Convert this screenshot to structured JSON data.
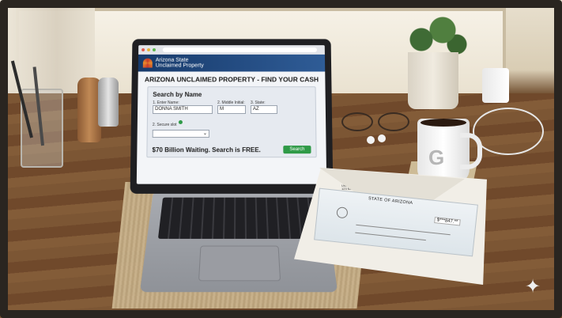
{
  "browser": {
    "controls": [
      "close",
      "minimize",
      "maximize"
    ]
  },
  "site": {
    "org_line1": "Arizona State",
    "org_line2": "Unclaimed Property",
    "page_title": "ARIZONA UNCLAIMED PROPERTY - FIND YOUR CASH",
    "search": {
      "heading": "Search by Name",
      "name_label": "1. Enter Name:",
      "name_value": "DONNA SMITH",
      "middle_label": "2. Middle Initial:",
      "middle_value": "M",
      "state_label": "3. State:",
      "state_value": "AZ",
      "secure_label": "2. Secure slot",
      "secure_value": "",
      "button_label": "Search"
    },
    "tagline": "$70 Billion Waiting. Search is FREE."
  },
  "envelope": {
    "return_address": [
      "STATE OF ARIZONA",
      "Unclaimed Property",
      "123 Main St",
      "Phoenix, AZ 85001"
    ]
  },
  "check": {
    "title": "STATE OF ARIZONA",
    "amount": "$***847.**"
  },
  "mug": {
    "logo": "G"
  },
  "colors": {
    "header_blue": "#173a6b",
    "button_green": "#2f9a47",
    "desk_wood": "#7c5634"
  },
  "icons": [
    "secure-check-icon",
    "dropdown-chevron-icon",
    "sparkle-icon"
  ]
}
